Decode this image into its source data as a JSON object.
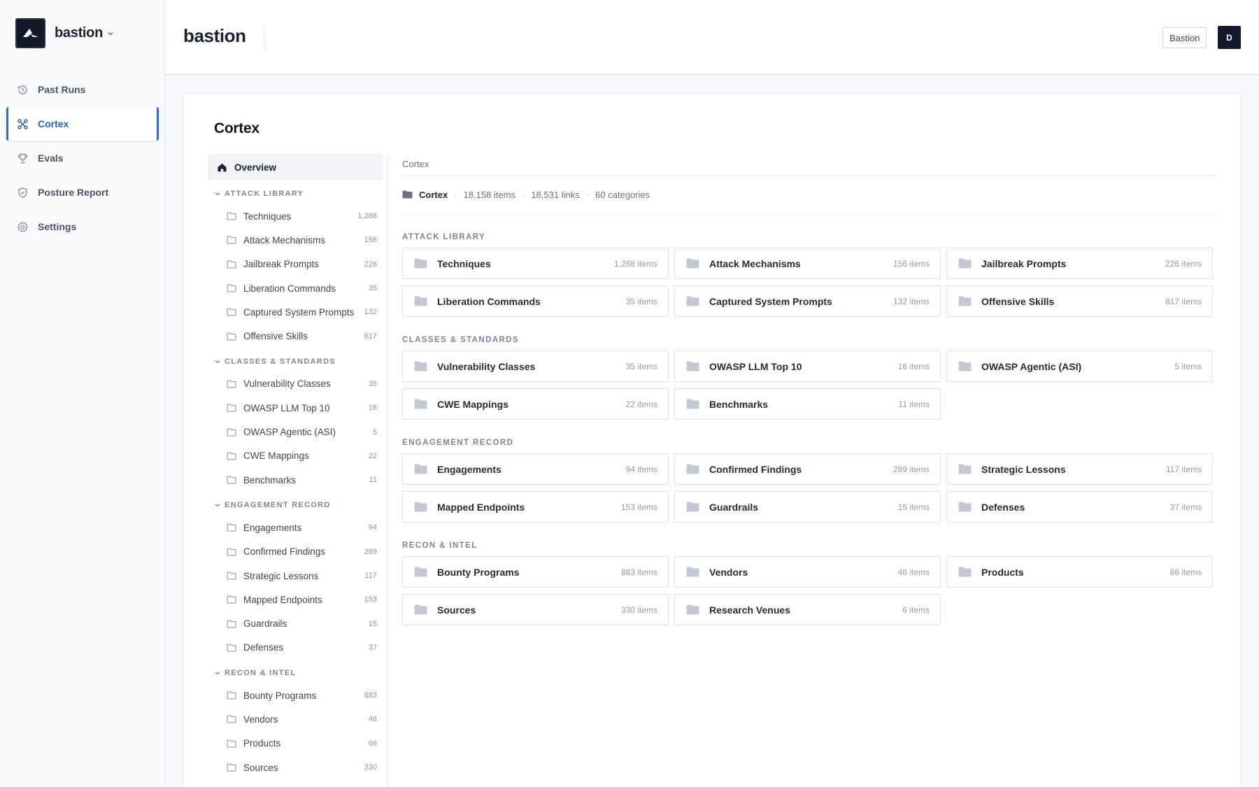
{
  "app": {
    "brand": "bastion",
    "page_title": "bastion",
    "org": "Bastion",
    "avatar_initial": "D"
  },
  "nav": [
    {
      "label": "Past Runs",
      "icon": "history-icon",
      "active": false
    },
    {
      "label": "Cortex",
      "icon": "graph-icon",
      "active": true
    },
    {
      "label": "Evals",
      "icon": "trophy-icon",
      "active": false
    },
    {
      "label": "Posture Report",
      "icon": "shield-icon",
      "active": false
    },
    {
      "label": "Settings",
      "icon": "gear-icon",
      "active": false
    }
  ],
  "card": {
    "title": "Cortex"
  },
  "tree": {
    "overview": "Overview",
    "sections": [
      {
        "title": "ATTACK LIBRARY",
        "items": [
          {
            "label": "Techniques",
            "count": "1,268"
          },
          {
            "label": "Attack Mechanisms",
            "count": "156"
          },
          {
            "label": "Jailbreak Prompts",
            "count": "226"
          },
          {
            "label": "Liberation Commands",
            "count": "35"
          },
          {
            "label": "Captured System Prompts",
            "count": "132"
          },
          {
            "label": "Offensive Skills",
            "count": "817"
          }
        ]
      },
      {
        "title": "CLASSES & STANDARDS",
        "items": [
          {
            "label": "Vulnerability Classes",
            "count": "35"
          },
          {
            "label": "OWASP LLM Top 10",
            "count": "16"
          },
          {
            "label": "OWASP Agentic (ASI)",
            "count": "5"
          },
          {
            "label": "CWE Mappings",
            "count": "22"
          },
          {
            "label": "Benchmarks",
            "count": "11"
          }
        ]
      },
      {
        "title": "ENGAGEMENT RECORD",
        "items": [
          {
            "label": "Engagements",
            "count": "94"
          },
          {
            "label": "Confirmed Findings",
            "count": "289"
          },
          {
            "label": "Strategic Lessons",
            "count": "117"
          },
          {
            "label": "Mapped Endpoints",
            "count": "153"
          },
          {
            "label": "Guardrails",
            "count": "15"
          },
          {
            "label": "Defenses",
            "count": "37"
          }
        ]
      },
      {
        "title": "RECON & INTEL",
        "items": [
          {
            "label": "Bounty Programs",
            "count": "883"
          },
          {
            "label": "Vendors",
            "count": "46"
          },
          {
            "label": "Products",
            "count": "66"
          },
          {
            "label": "Sources",
            "count": "330"
          }
        ]
      }
    ]
  },
  "content": {
    "breadcrumb": "Cortex",
    "stats": {
      "root": "Cortex",
      "items": "18,158 items",
      "links": "18,531 links",
      "categories": "60 categories"
    },
    "sections": [
      {
        "title": "ATTACK LIBRARY",
        "tiles": [
          {
            "name": "Techniques",
            "count": "1,268 items"
          },
          {
            "name": "Attack Mechanisms",
            "count": "156 items"
          },
          {
            "name": "Jailbreak Prompts",
            "count": "226 items"
          },
          {
            "name": "Liberation Commands",
            "count": "35 items"
          },
          {
            "name": "Captured System Prompts",
            "count": "132 items"
          },
          {
            "name": "Offensive Skills",
            "count": "817 items"
          }
        ]
      },
      {
        "title": "CLASSES & STANDARDS",
        "tiles": [
          {
            "name": "Vulnerability Classes",
            "count": "35 items"
          },
          {
            "name": "OWASP LLM Top 10",
            "count": "16 items"
          },
          {
            "name": "OWASP Agentic (ASI)",
            "count": "5 items"
          },
          {
            "name": "CWE Mappings",
            "count": "22 items"
          },
          {
            "name": "Benchmarks",
            "count": "11 items"
          }
        ]
      },
      {
        "title": "ENGAGEMENT RECORD",
        "tiles": [
          {
            "name": "Engagements",
            "count": "94 items"
          },
          {
            "name": "Confirmed Findings",
            "count": "289 items"
          },
          {
            "name": "Strategic Lessons",
            "count": "117 items"
          },
          {
            "name": "Mapped Endpoints",
            "count": "153 items"
          },
          {
            "name": "Guardrails",
            "count": "15 items"
          },
          {
            "name": "Defenses",
            "count": "37 items"
          }
        ]
      },
      {
        "title": "RECON & INTEL",
        "tiles": [
          {
            "name": "Bounty Programs",
            "count": "883 items"
          },
          {
            "name": "Vendors",
            "count": "46 items"
          },
          {
            "name": "Products",
            "count": "66 items"
          },
          {
            "name": "Sources",
            "count": "330 items"
          },
          {
            "name": "Research Venues",
            "count": "6 items"
          }
        ]
      }
    ]
  },
  "colors": {
    "accent": "#2f6bd6",
    "dark": "#111827",
    "folder": "#c3c9d3"
  }
}
